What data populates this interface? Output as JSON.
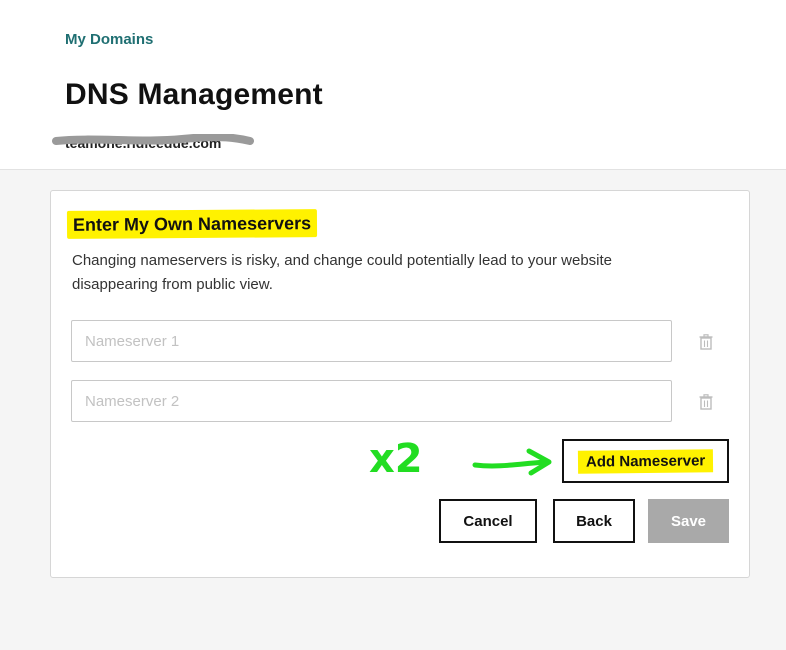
{
  "header": {
    "breadcrumb": "My Domains",
    "title": "DNS Management",
    "domain_name": "teamone.ridleedue.com"
  },
  "nameservers_card": {
    "heading": "Enter My Own Nameservers",
    "description": "Changing nameservers is risky, and change could potentially lead to your website disappearing from public view.",
    "inputs": [
      {
        "value": "",
        "placeholder": "Nameserver 1"
      },
      {
        "value": "",
        "placeholder": "Nameserver 2"
      }
    ],
    "add_button_label": "Add Nameserver",
    "cancel_label": "Cancel",
    "back_label": "Back",
    "save_label": "Save"
  },
  "annotation": {
    "text": "x2"
  },
  "colors": {
    "page_background": "#f5f5f5",
    "breadcrumb_link": "#1f6f72",
    "highlight": "#fff200",
    "annotation_green": "#22dd22",
    "save_disabled": "#a9a9a9",
    "redaction": "#9a9a9a"
  },
  "icons": {
    "delete": "trash-icon"
  }
}
